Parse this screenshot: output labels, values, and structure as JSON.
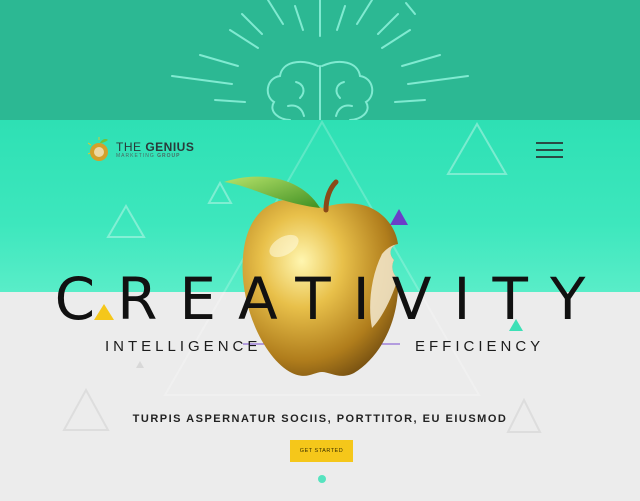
{
  "brand": {
    "name_light": "THE",
    "name_bold": "GENIUS",
    "subtitle_light": "MARKETING",
    "subtitle_bold": "GROUP"
  },
  "hero": {
    "headline": "CREATIVITY",
    "left_word": "INTELLIGENCE",
    "right_word": "EFFICIENCY",
    "tagline": "TURPIS ASPERNATUR SOCIIS, PORTTITOR, EU EIUSMOD",
    "cta_label": "GET STARTED"
  },
  "colors": {
    "top_band": "#2cb893",
    "hero_mint": "#3de7bd",
    "accent_yellow": "#f5c71a",
    "accent_purple": "#6a3fc8"
  },
  "icons": {
    "brain": "brain-icon",
    "apple": "apple-icon",
    "menu": "hamburger-menu-icon"
  }
}
